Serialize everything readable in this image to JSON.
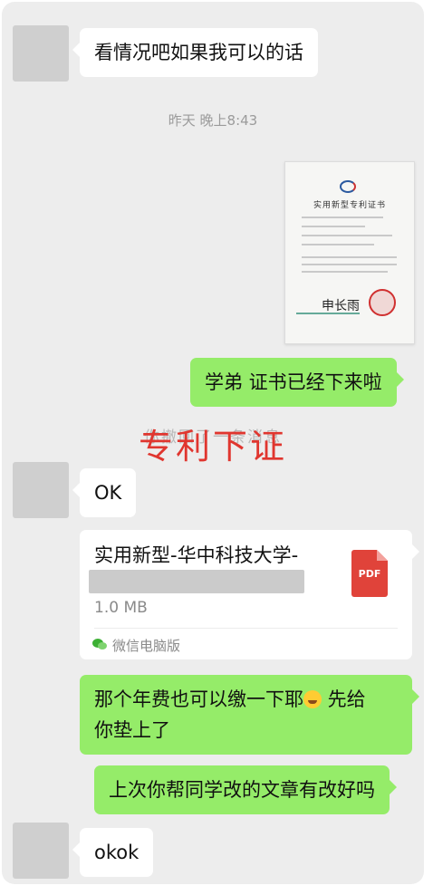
{
  "messages": {
    "m1": "看情况吧如果我可以的话",
    "timestamp": "昨天 晚上8:43",
    "m2": "学弟 证书已经下来啦",
    "overlay_behind": "你撤回了一条消息",
    "overlay_title": "专利下证",
    "m3": "OK",
    "m4_part1": "那个年费也可以缴一下耶",
    "m4_part2": " 先给",
    "m4_line2": "你垫上了",
    "m5": "上次你帮同学改的文章有改好吗",
    "m6": "okok"
  },
  "certificate": {
    "title": "实用新型专利证书"
  },
  "file": {
    "name": "实用新型-华中科技大学-",
    "size": "1.0 MB",
    "source": "微信电脑版",
    "type_label": "PDF"
  },
  "colors": {
    "chat_bg": "#ededed",
    "bubble_out": "#95ec69",
    "bubble_in": "#ffffff",
    "overlay_red": "#e0362f",
    "pdf_red": "#e0433a"
  }
}
